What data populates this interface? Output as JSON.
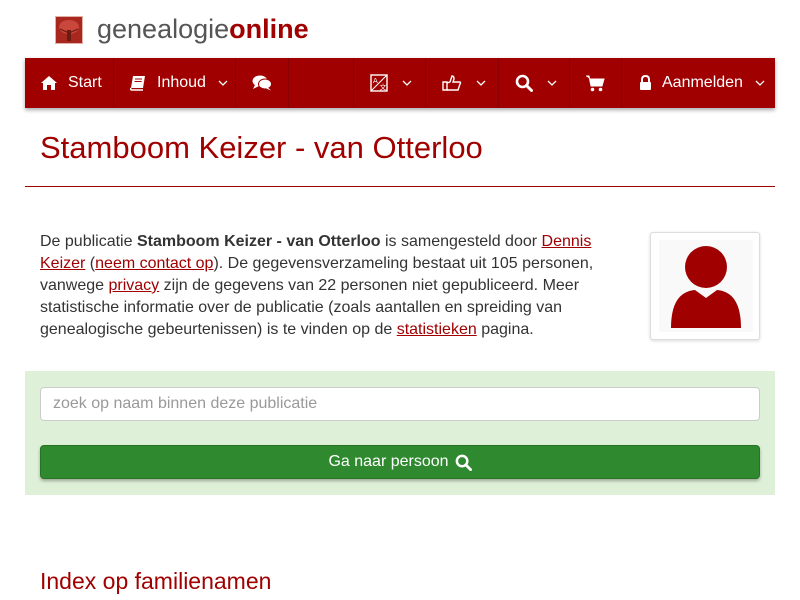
{
  "site": {
    "logo_part1": "genealogie",
    "logo_part2": "online"
  },
  "nav": {
    "start_label": "Start",
    "inhoud_label": "Inhoud",
    "aanmelden_label": "Aanmelden"
  },
  "page": {
    "title": "Stamboom Keizer - van Otterloo"
  },
  "intro": {
    "t1": "De publicatie ",
    "pub_name": "Stamboom Keizer - van Otterloo",
    "t2": " is samengesteld door ",
    "author_link": "Dennis Keizer",
    "t3": " (",
    "contact_link": "neem contact op",
    "t4": "). De gegevensverzameling bestaat uit 105 personen, vanwege ",
    "privacy_link": "privacy",
    "t5": " zijn de gegevens van 22 personen niet gepubliceerd. Meer statistische informatie over de publicatie (zoals aantallen en spreiding van genealogische gebeurtenissen) is te vinden op de ",
    "stats_link": "statistieken",
    "t6": " pagina."
  },
  "search": {
    "placeholder": "zoek op naam binnen deze publicatie",
    "button_label": "Ga naar persoon"
  },
  "sections": {
    "index_title": "Index op familienamen"
  },
  "colors": {
    "brand": "#a00000",
    "success": "#2f8a2f",
    "panel": "#dff0d8"
  },
  "icons": [
    "tree-logo-icon",
    "home-icon",
    "book-icon",
    "chat-icon",
    "translate-icon",
    "thumbs-up-icon",
    "search-icon",
    "cart-icon",
    "lock-icon",
    "chevron-down-icon",
    "person-icon"
  ]
}
